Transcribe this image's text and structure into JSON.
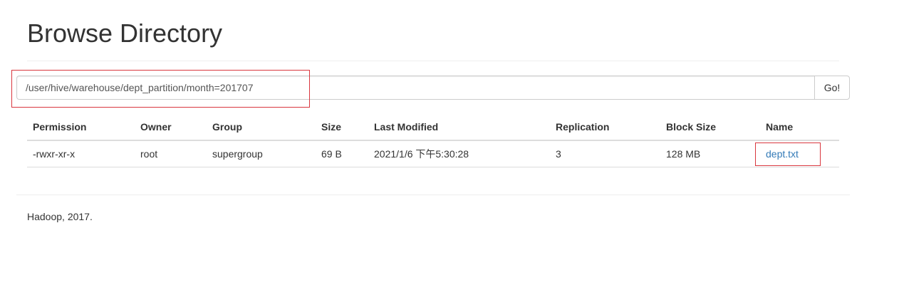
{
  "header": {
    "title": "Browse Directory"
  },
  "path_bar": {
    "value": "/user/hive/warehouse/dept_partition/month=201707",
    "go_label": "Go!"
  },
  "table": {
    "columns": {
      "permission": "Permission",
      "owner": "Owner",
      "group": "Group",
      "size": "Size",
      "last_modified": "Last Modified",
      "replication": "Replication",
      "block_size": "Block Size",
      "name": "Name"
    },
    "rows": [
      {
        "permission": "-rwxr-xr-x",
        "owner": "root",
        "group": "supergroup",
        "size": "69 B",
        "last_modified": "2021/1/6 下午5:30:28",
        "replication": "3",
        "block_size": "128 MB",
        "name": "dept.txt"
      }
    ]
  },
  "footer": {
    "text": "Hadoop, 2017."
  },
  "colors": {
    "link": "#337ab7",
    "annotation_box": "#d9363e"
  }
}
